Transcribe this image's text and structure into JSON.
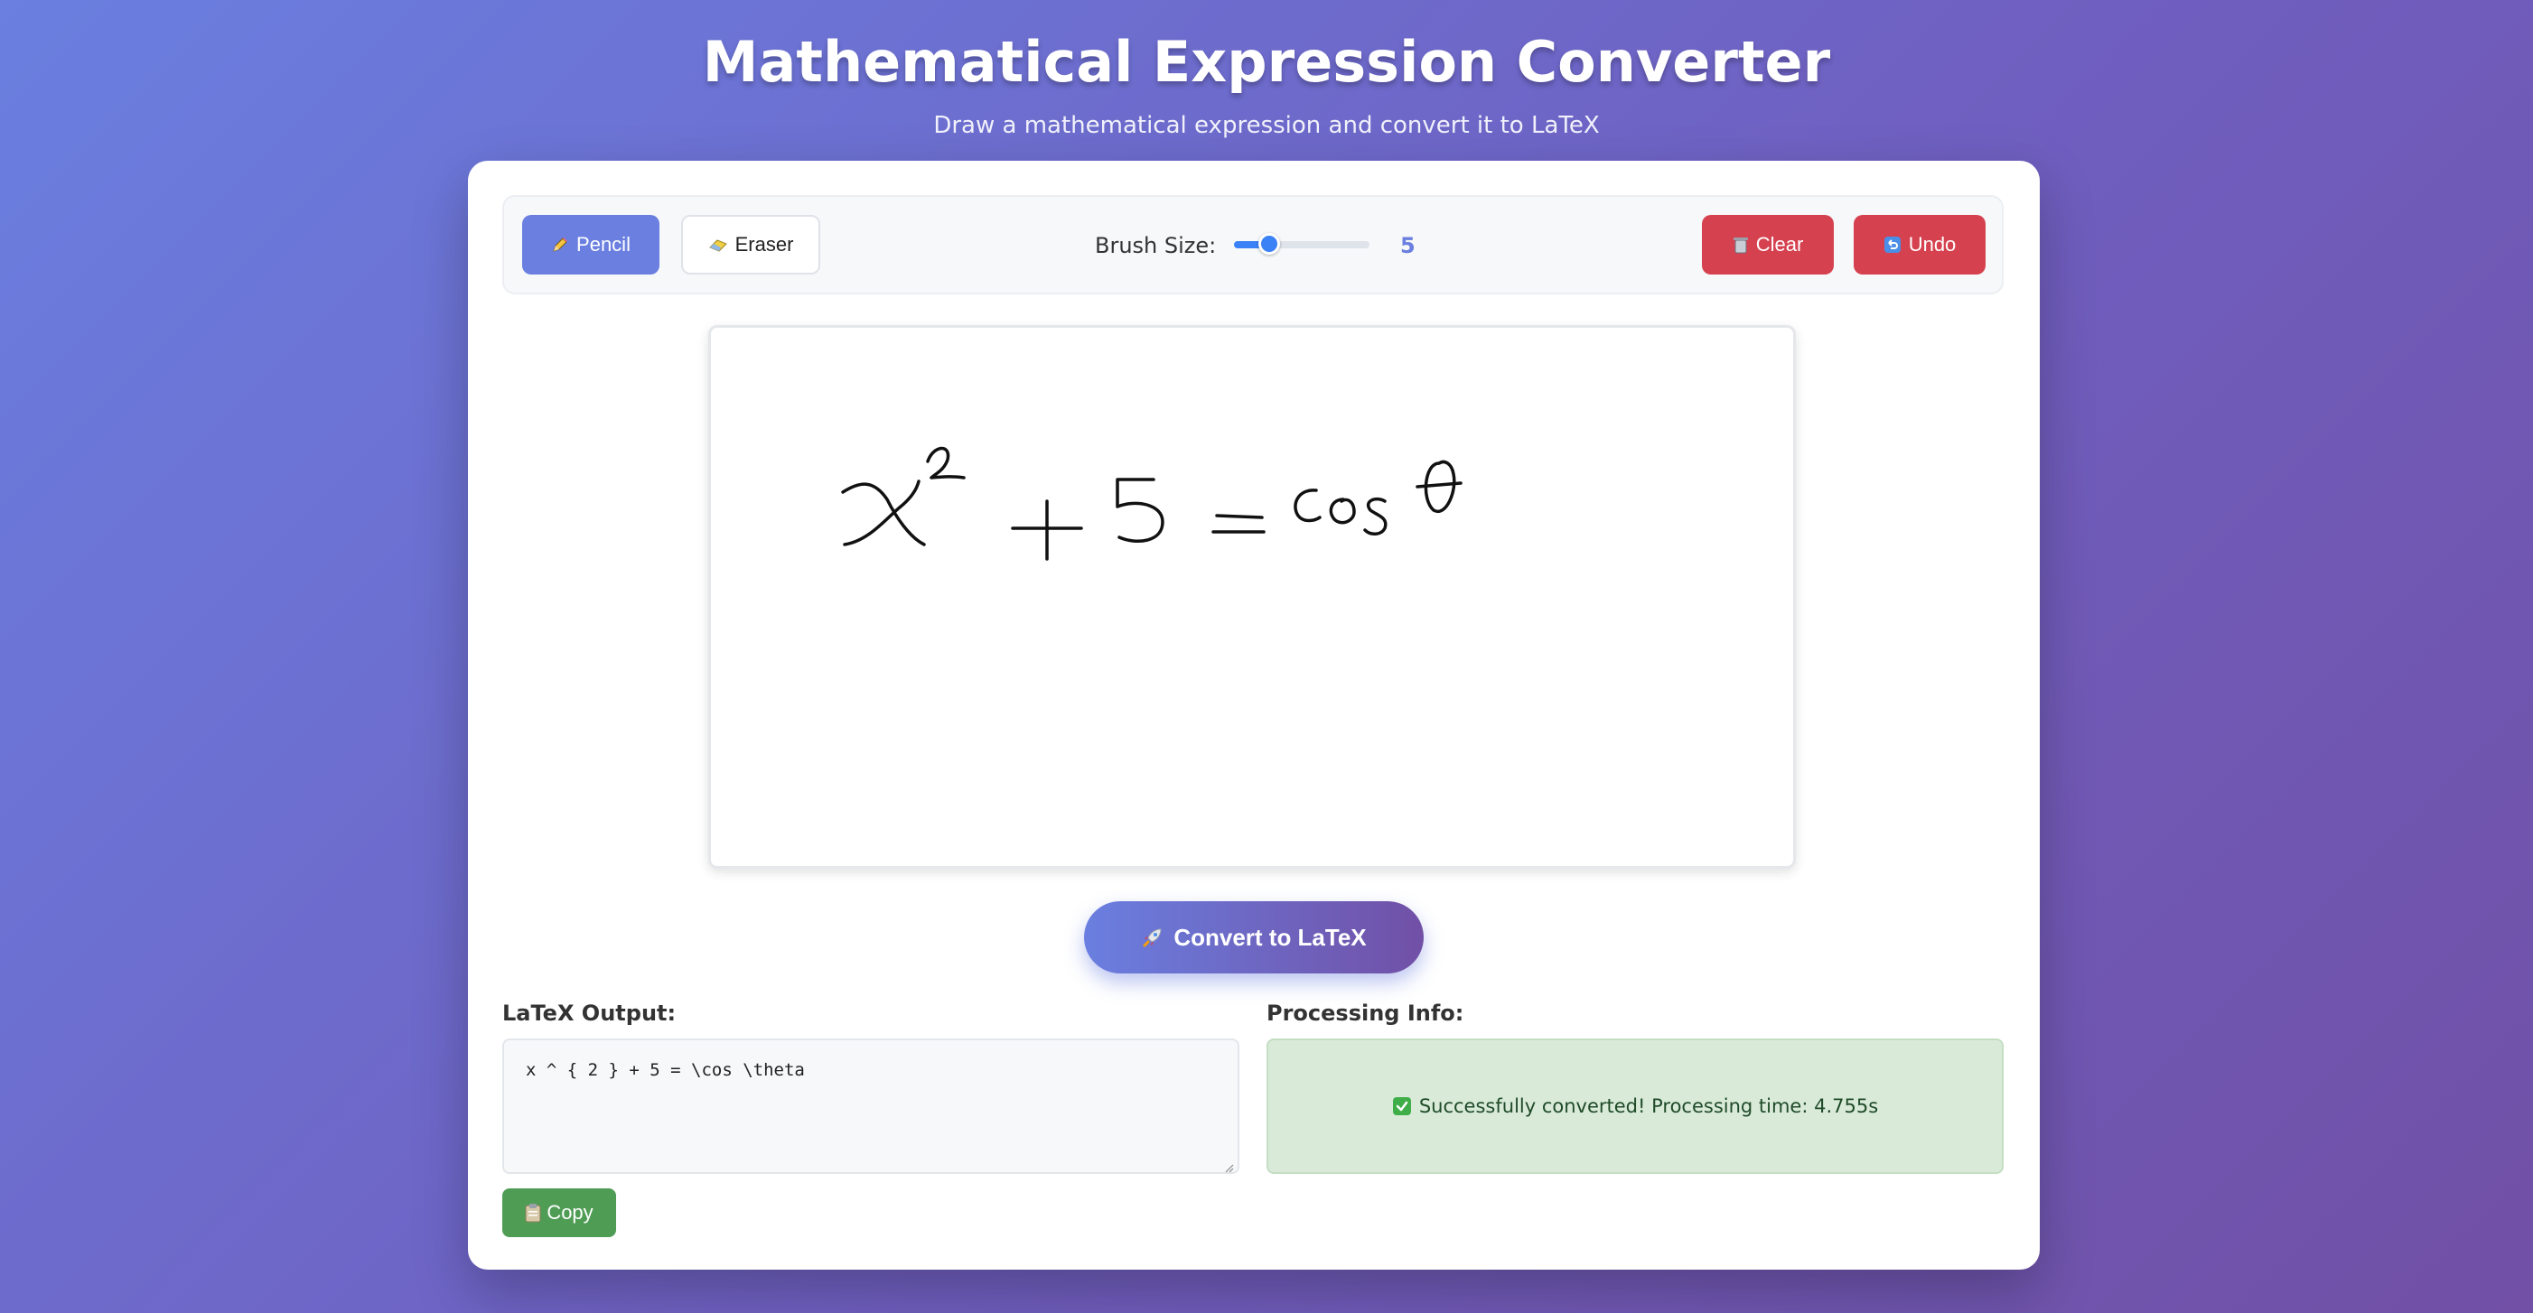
{
  "header": {
    "title": "Mathematical Expression Converter",
    "subtitle": "Draw a mathematical expression and convert it to LaTeX"
  },
  "toolbar": {
    "pencil": {
      "label": "Pencil",
      "icon": "pencil-icon",
      "active": true
    },
    "eraser": {
      "label": "Eraser",
      "icon": "eraser-icon"
    },
    "brush_label": "Brush Size:",
    "brush_value": "5",
    "brush_min": 1,
    "brush_max": 20,
    "clear": {
      "label": "Clear",
      "icon": "trash-icon"
    },
    "undo": {
      "label": "Undo",
      "icon": "undo-icon"
    }
  },
  "canvas": {
    "drawn_expression": "x^2 + 5 = cos θ"
  },
  "convert": {
    "label": "Convert to LaTeX",
    "icon": "rocket-icon"
  },
  "output": {
    "label": "LaTeX Output:",
    "value": "x ^ { 2 } + 5 = \\cos \\theta",
    "copy_label": "Copy",
    "copy_icon": "clipboard-icon"
  },
  "info": {
    "label": "Processing Info:",
    "message": "Successfully converted! Processing time: 4.755s",
    "icon": "check-icon"
  },
  "colors": {
    "accent": "#6a7fe0",
    "danger": "#d5414f",
    "success_bg": "#d9ead9",
    "copy": "#4f9d55",
    "slider": "#3b82f6"
  }
}
